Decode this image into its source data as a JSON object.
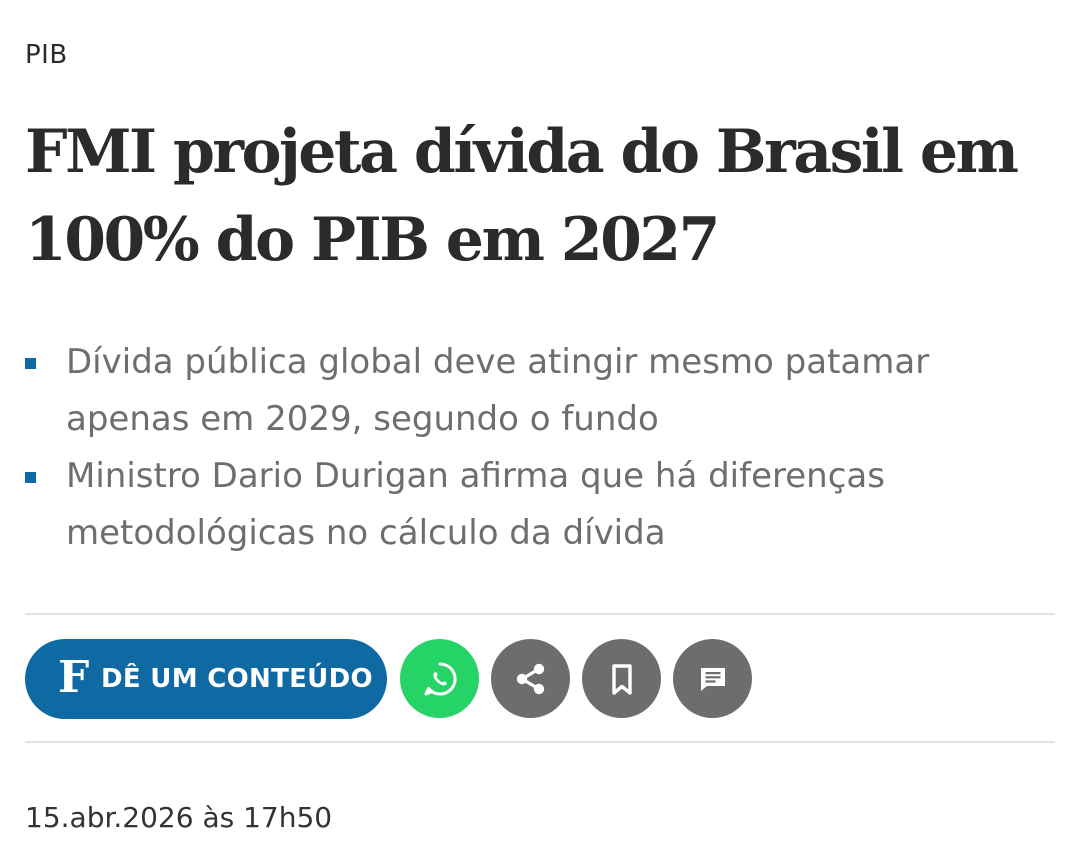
{
  "article": {
    "kicker": "PIB",
    "headline": "FMI projeta dívida do Brasil em 100% do PIB em 2027",
    "bullets": [
      "Dívida pública global deve atingir mesmo patamar apenas em 2029, segundo o fundo",
      "Ministro Dario Durigan afirma que há diferenças metodológicas no cálculo da dívida"
    ],
    "timestamp": "15.abr.2026 às 17h50"
  },
  "actions": {
    "gift": {
      "logo": "F",
      "label": "DÊ UM CONTEÚDO"
    },
    "whatsapp_icon": "whatsapp-icon",
    "share_icon": "share-icon",
    "bookmark_icon": "bookmark-icon",
    "comment_icon": "comment-icon"
  },
  "colors": {
    "accent_blue": "#0f6aa3",
    "whatsapp_green": "#25d366",
    "icon_button_gray": "#6d6d6d",
    "bullet_text_gray": "#6e6e6e"
  }
}
